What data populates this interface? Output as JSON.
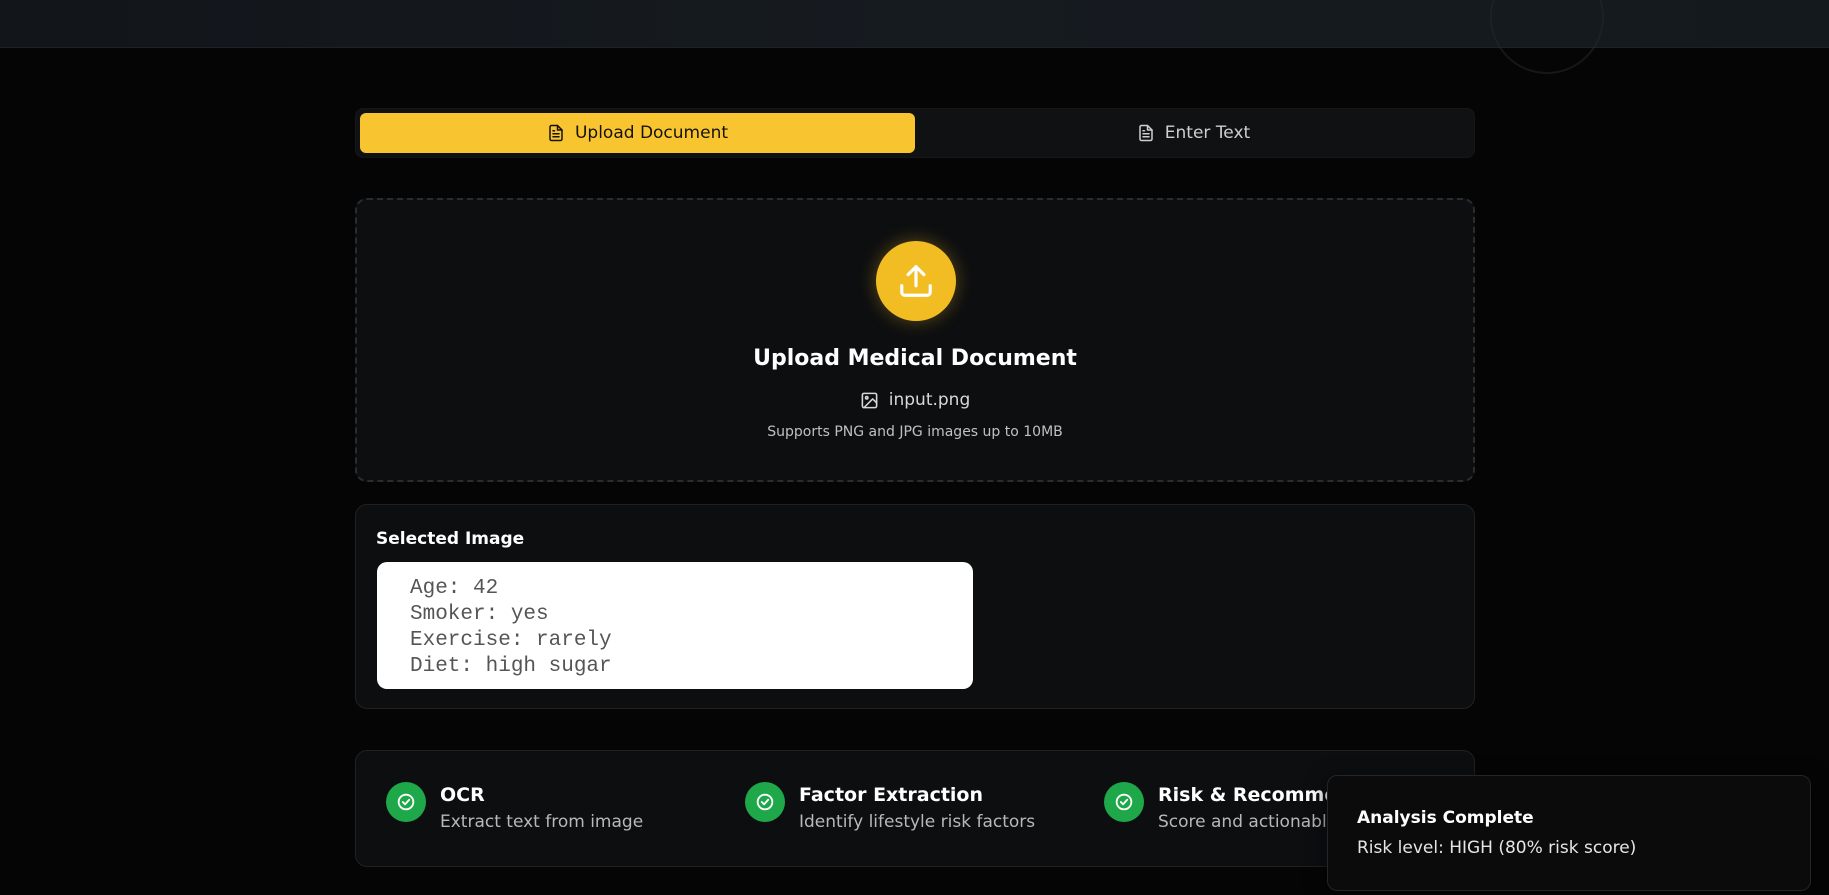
{
  "tabs": {
    "upload_label": "Upload Document",
    "text_label": "Enter Text",
    "active": "upload",
    "icon": "document-icon"
  },
  "upload": {
    "title": "Upload Medical Document",
    "file_name": "input.png",
    "hint": "Supports PNG and JPG images up to 10MB",
    "icon": "upload-icon",
    "file_icon": "image-icon"
  },
  "selected": {
    "label": "Selected Image",
    "lines": [
      "Age: 42",
      "Smoker: yes",
      "Exercise: rarely",
      "Diet: high sugar"
    ]
  },
  "steps": [
    {
      "title": "OCR",
      "desc": "Extract text from image",
      "status": "complete"
    },
    {
      "title": "Factor Extraction",
      "desc": "Identify lifestyle risk factors",
      "status": "complete"
    },
    {
      "title": "Risk & Recommendations",
      "desc": "Score and actionable guidance",
      "status": "complete"
    }
  ],
  "toast": {
    "title": "Analysis Complete",
    "desc": "Risk level: HIGH (80% risk score)"
  },
  "colors": {
    "accent": "#f8c531",
    "success": "#1ea84a",
    "background": "#050505",
    "card": "#0d0e10"
  }
}
